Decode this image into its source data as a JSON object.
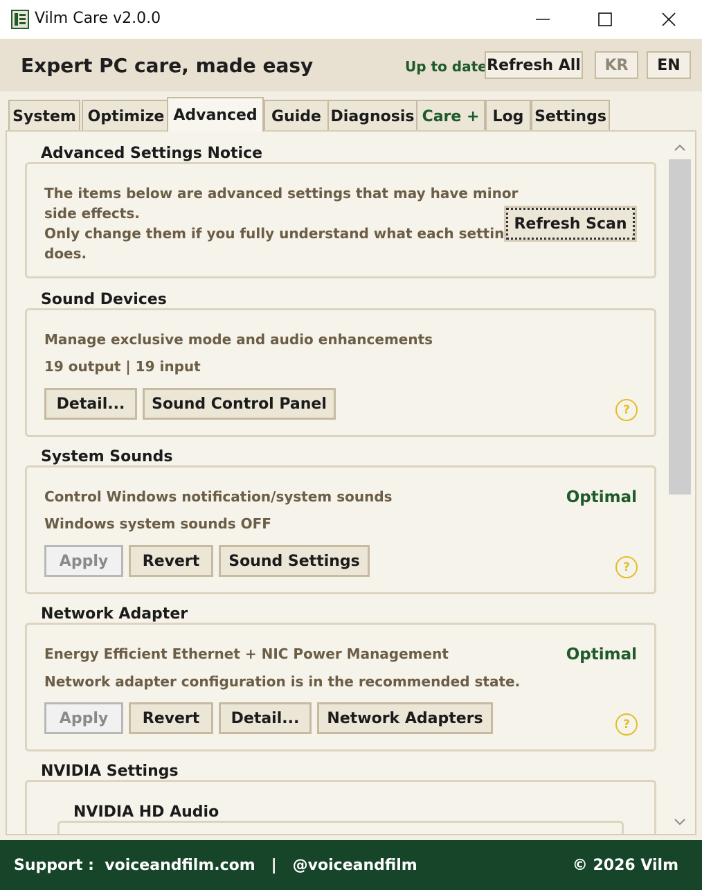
{
  "window": {
    "title": "Vilm Care v2.0.0",
    "icon": "app-logo-icon",
    "controls": [
      "minimize-icon",
      "maximize-icon",
      "close-icon"
    ]
  },
  "header": {
    "tagline": "Expert PC care, made easy",
    "status": "Up to date",
    "refresh_all": "Refresh All",
    "lang_kr": "KR",
    "lang_en": "EN"
  },
  "tabs": [
    {
      "label": "System"
    },
    {
      "label": "Optimize"
    },
    {
      "label": "Advanced"
    },
    {
      "label": "Guide"
    },
    {
      "label": "Diagnosis"
    },
    {
      "label": "Care +"
    },
    {
      "label": "Log"
    },
    {
      "label": "Settings"
    }
  ],
  "active_tab": "Advanced",
  "notice": {
    "title": "Advanced Settings Notice",
    "line1": "The items below are advanced settings that may have minor",
    "line2": "side effects.",
    "line3": "Only change them if you fully understand what each setting",
    "line4": "does.",
    "refresh_scan": "Refresh Scan"
  },
  "sound_devices": {
    "title": "Sound Devices",
    "desc": "Manage exclusive mode and audio enhancements",
    "detail": "19 output | 19 input",
    "btn_detail": "Detail...",
    "btn_panel": "Sound Control Panel",
    "help": "?"
  },
  "system_sounds": {
    "title": "System Sounds",
    "desc": "Control Windows notification/system sounds",
    "detail": "Windows system sounds OFF",
    "status": "Optimal",
    "btn_apply": "Apply",
    "btn_revert": "Revert",
    "btn_settings": "Sound Settings",
    "help": "?"
  },
  "network_adapter": {
    "title": "Network Adapter",
    "desc": "Energy Efficient Ethernet + NIC Power Management",
    "detail": "Network adapter configuration is in the recommended state.",
    "status": "Optimal",
    "btn_apply": "Apply",
    "btn_revert": "Revert",
    "btn_detail": "Detail...",
    "btn_adapters": "Network Adapters",
    "help": "?"
  },
  "nvidia": {
    "title": "NVIDIA Settings",
    "sub_title": "NVIDIA HD Audio"
  },
  "footer": {
    "support": "Support :  voiceandfilm.com   |   @voiceandfilm",
    "copyright": "© 2026 Vilm"
  }
}
